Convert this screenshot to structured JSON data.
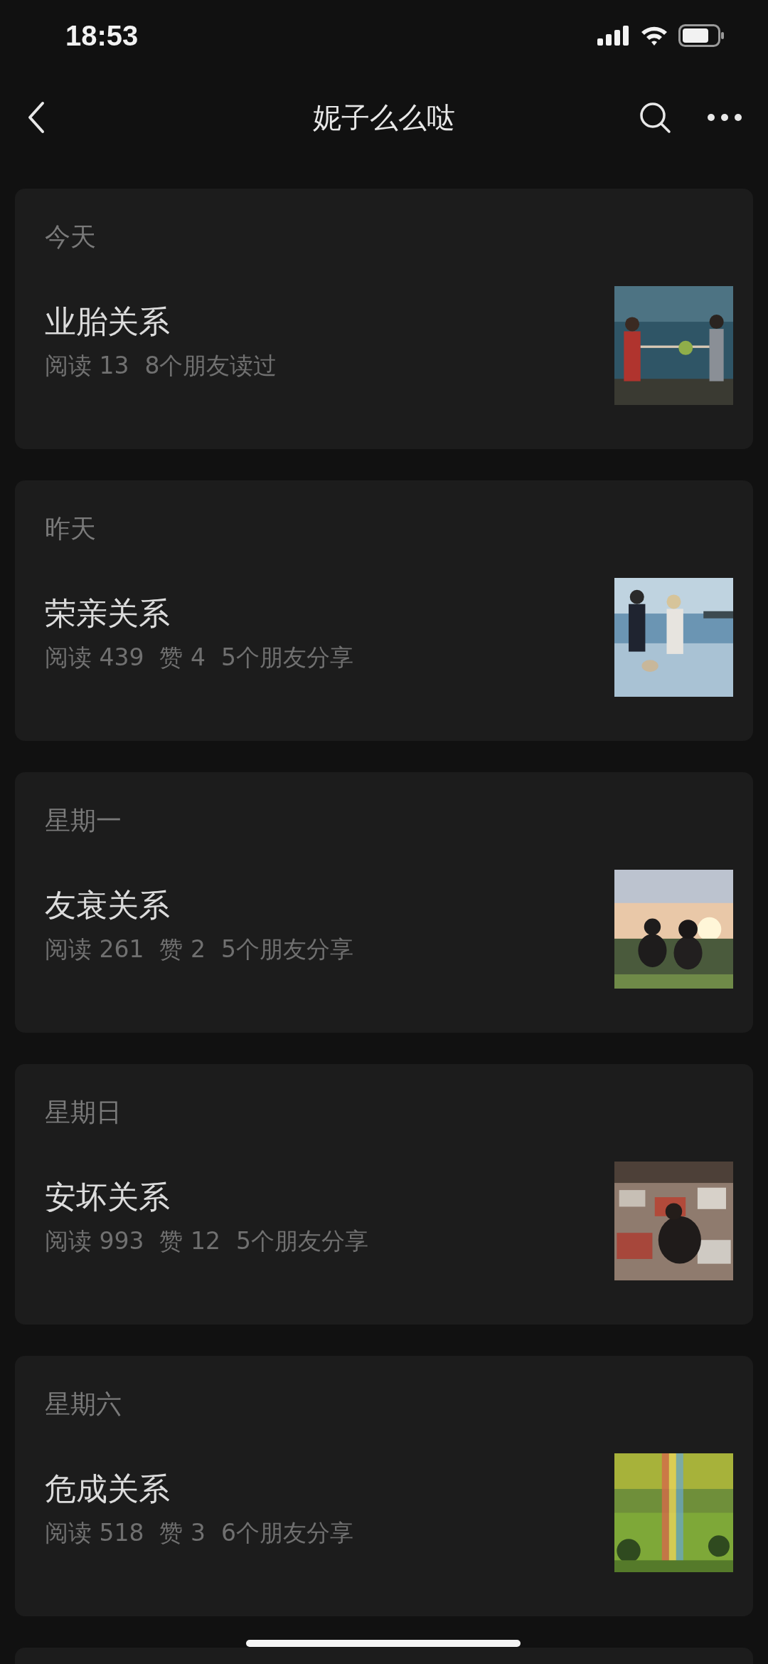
{
  "status_bar": {
    "time": "18:53"
  },
  "nav": {
    "title": "妮子么么哒"
  },
  "articles": [
    {
      "date": "今天",
      "title": "业胎关系",
      "meta": [
        "阅读 13",
        "8个朋友读过"
      ],
      "thumbnail": {
        "kind": "picture"
      }
    },
    {
      "date": "昨天",
      "title": "荣亲关系",
      "meta": [
        "阅读 439",
        "赞 4",
        "5个朋友分享"
      ],
      "thumbnail": {
        "kind": "picture"
      }
    },
    {
      "date": "星期一",
      "title": "友衰关系",
      "meta": [
        "阅读 261",
        "赞 2",
        "5个朋友分享"
      ],
      "thumbnail": {
        "kind": "picture"
      }
    },
    {
      "date": "星期日",
      "title": "安坏关系",
      "meta": [
        "阅读 993",
        "赞 12",
        "5个朋友分享"
      ],
      "thumbnail": {
        "kind": "picture"
      }
    },
    {
      "date": "星期六",
      "title": "危成关系",
      "meta": [
        "阅读 518",
        "赞 3",
        "6个朋友分享"
      ],
      "thumbnail": {
        "kind": "picture"
      }
    }
  ]
}
